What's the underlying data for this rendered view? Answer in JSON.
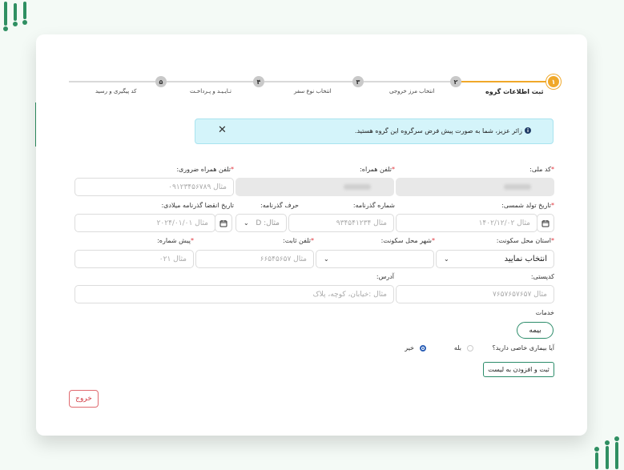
{
  "colors": {
    "brand": "#2f8f62",
    "accent": "#f0a829",
    "required": "#e0323a",
    "info_bg": "#d4f4fa"
  },
  "stepper": {
    "steps": [
      {
        "number": "۱",
        "label": "ثبت اطلاعات گروه",
        "active": true
      },
      {
        "number": "۲",
        "label": "انتخاب مرز خروجی",
        "active": false
      },
      {
        "number": "۳",
        "label": "انتخاب نوع سفر",
        "active": false
      },
      {
        "number": "۴",
        "label": "تـایـیـد و پـرداخـت",
        "active": false
      },
      {
        "number": "۵",
        "label": "کد پیگیری و رسید",
        "active": false
      }
    ]
  },
  "alert": {
    "text": "زائر عزیز، شما به صورت پیش فرض سرگروه این گروه هستید.",
    "info_icon": "i",
    "close_icon": "✕"
  },
  "form": {
    "national_code": {
      "label": "کد ملی:",
      "required": "*"
    },
    "mobile": {
      "label": "تلفن همراه:",
      "required": "*"
    },
    "emergency_mobile": {
      "label": "تلفن همراه ضروری:",
      "required": "*",
      "placeholder": "مثال ۰۹۱۲۳۴۵۶۷۸۹"
    },
    "birth_date": {
      "label": "تاریخ تولد شمسی:",
      "required": "*",
      "placeholder": "مثال ۱۴۰۲/۱۲/۰۲"
    },
    "passport_number": {
      "label": "شماره گذرنامه:",
      "placeholder": "مثال ۹۳۴۵۴۱۲۳۴"
    },
    "passport_letter": {
      "label": "حرف گذرنامه:",
      "placeholder": "مثال: D"
    },
    "passport_expiry": {
      "label": "تاریخ انقضا گذرنامه میلادی:",
      "placeholder": "مثال ۲۰۲۴/۰۱/۰۱"
    },
    "province": {
      "label": "استان محل سکونت:",
      "required": "*",
      "value": "انتخاب نمایید"
    },
    "city": {
      "label": "شهر محل سکونت:",
      "required": "*"
    },
    "landline": {
      "label": "تلفن ثابت:",
      "required": "*",
      "placeholder": "مثال ۶۶۵۴۵۶۵۷"
    },
    "area_code": {
      "label": "پیش شماره:",
      "required": "*",
      "placeholder": "مثال ۰۲۱"
    },
    "postal_code": {
      "label": "کدپستی:",
      "placeholder": "مثال ۷۶۵۷۶۵۷۶۵۷"
    },
    "address": {
      "label": "آدرس:",
      "placeholder": "مثال :خیابان، کوچه، پلاک"
    },
    "services": {
      "label": "خدمات",
      "chip": "بیمه"
    },
    "disease": {
      "question": "آیا بیماری خاصی دارید؟",
      "yes": "بله",
      "no": "خیر",
      "selected": "no"
    }
  },
  "buttons": {
    "add_to_list": "ثبت و افزودن به لیست",
    "exit": "خروج"
  }
}
